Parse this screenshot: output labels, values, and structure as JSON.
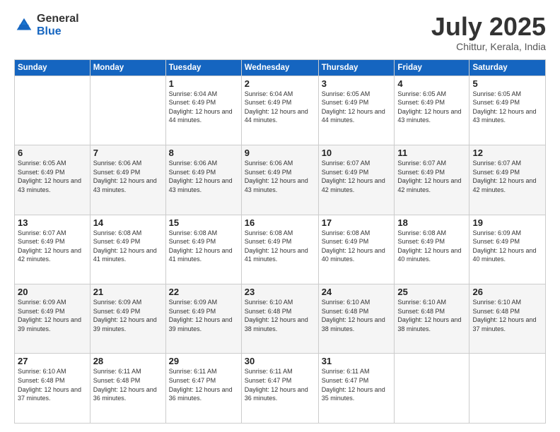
{
  "header": {
    "logo_general": "General",
    "logo_blue": "Blue",
    "title": "July 2025",
    "subtitle": "Chittur, Kerala, India"
  },
  "calendar": {
    "weekdays": [
      "Sunday",
      "Monday",
      "Tuesday",
      "Wednesday",
      "Thursday",
      "Friday",
      "Saturday"
    ],
    "weeks": [
      [
        {
          "day": "",
          "info": ""
        },
        {
          "day": "",
          "info": ""
        },
        {
          "day": "1",
          "info": "Sunrise: 6:04 AM\nSunset: 6:49 PM\nDaylight: 12 hours and 44 minutes."
        },
        {
          "day": "2",
          "info": "Sunrise: 6:04 AM\nSunset: 6:49 PM\nDaylight: 12 hours and 44 minutes."
        },
        {
          "day": "3",
          "info": "Sunrise: 6:05 AM\nSunset: 6:49 PM\nDaylight: 12 hours and 44 minutes."
        },
        {
          "day": "4",
          "info": "Sunrise: 6:05 AM\nSunset: 6:49 PM\nDaylight: 12 hours and 43 minutes."
        },
        {
          "day": "5",
          "info": "Sunrise: 6:05 AM\nSunset: 6:49 PM\nDaylight: 12 hours and 43 minutes."
        }
      ],
      [
        {
          "day": "6",
          "info": "Sunrise: 6:05 AM\nSunset: 6:49 PM\nDaylight: 12 hours and 43 minutes."
        },
        {
          "day": "7",
          "info": "Sunrise: 6:06 AM\nSunset: 6:49 PM\nDaylight: 12 hours and 43 minutes."
        },
        {
          "day": "8",
          "info": "Sunrise: 6:06 AM\nSunset: 6:49 PM\nDaylight: 12 hours and 43 minutes."
        },
        {
          "day": "9",
          "info": "Sunrise: 6:06 AM\nSunset: 6:49 PM\nDaylight: 12 hours and 43 minutes."
        },
        {
          "day": "10",
          "info": "Sunrise: 6:07 AM\nSunset: 6:49 PM\nDaylight: 12 hours and 42 minutes."
        },
        {
          "day": "11",
          "info": "Sunrise: 6:07 AM\nSunset: 6:49 PM\nDaylight: 12 hours and 42 minutes."
        },
        {
          "day": "12",
          "info": "Sunrise: 6:07 AM\nSunset: 6:49 PM\nDaylight: 12 hours and 42 minutes."
        }
      ],
      [
        {
          "day": "13",
          "info": "Sunrise: 6:07 AM\nSunset: 6:49 PM\nDaylight: 12 hours and 42 minutes."
        },
        {
          "day": "14",
          "info": "Sunrise: 6:08 AM\nSunset: 6:49 PM\nDaylight: 12 hours and 41 minutes."
        },
        {
          "day": "15",
          "info": "Sunrise: 6:08 AM\nSunset: 6:49 PM\nDaylight: 12 hours and 41 minutes."
        },
        {
          "day": "16",
          "info": "Sunrise: 6:08 AM\nSunset: 6:49 PM\nDaylight: 12 hours and 41 minutes."
        },
        {
          "day": "17",
          "info": "Sunrise: 6:08 AM\nSunset: 6:49 PM\nDaylight: 12 hours and 40 minutes."
        },
        {
          "day": "18",
          "info": "Sunrise: 6:08 AM\nSunset: 6:49 PM\nDaylight: 12 hours and 40 minutes."
        },
        {
          "day": "19",
          "info": "Sunrise: 6:09 AM\nSunset: 6:49 PM\nDaylight: 12 hours and 40 minutes."
        }
      ],
      [
        {
          "day": "20",
          "info": "Sunrise: 6:09 AM\nSunset: 6:49 PM\nDaylight: 12 hours and 39 minutes."
        },
        {
          "day": "21",
          "info": "Sunrise: 6:09 AM\nSunset: 6:49 PM\nDaylight: 12 hours and 39 minutes."
        },
        {
          "day": "22",
          "info": "Sunrise: 6:09 AM\nSunset: 6:49 PM\nDaylight: 12 hours and 39 minutes."
        },
        {
          "day": "23",
          "info": "Sunrise: 6:10 AM\nSunset: 6:48 PM\nDaylight: 12 hours and 38 minutes."
        },
        {
          "day": "24",
          "info": "Sunrise: 6:10 AM\nSunset: 6:48 PM\nDaylight: 12 hours and 38 minutes."
        },
        {
          "day": "25",
          "info": "Sunrise: 6:10 AM\nSunset: 6:48 PM\nDaylight: 12 hours and 38 minutes."
        },
        {
          "day": "26",
          "info": "Sunrise: 6:10 AM\nSunset: 6:48 PM\nDaylight: 12 hours and 37 minutes."
        }
      ],
      [
        {
          "day": "27",
          "info": "Sunrise: 6:10 AM\nSunset: 6:48 PM\nDaylight: 12 hours and 37 minutes."
        },
        {
          "day": "28",
          "info": "Sunrise: 6:11 AM\nSunset: 6:48 PM\nDaylight: 12 hours and 36 minutes."
        },
        {
          "day": "29",
          "info": "Sunrise: 6:11 AM\nSunset: 6:47 PM\nDaylight: 12 hours and 36 minutes."
        },
        {
          "day": "30",
          "info": "Sunrise: 6:11 AM\nSunset: 6:47 PM\nDaylight: 12 hours and 36 minutes."
        },
        {
          "day": "31",
          "info": "Sunrise: 6:11 AM\nSunset: 6:47 PM\nDaylight: 12 hours and 35 minutes."
        },
        {
          "day": "",
          "info": ""
        },
        {
          "day": "",
          "info": ""
        }
      ]
    ]
  }
}
